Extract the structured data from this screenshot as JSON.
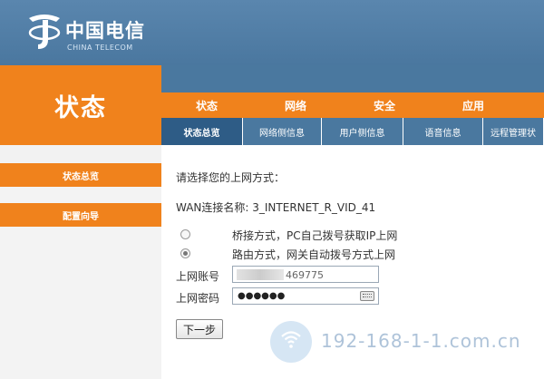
{
  "logo": {
    "cn": "中国电信",
    "en": "CHINA TELECOM"
  },
  "sidebar": {
    "title": "状态",
    "items": [
      {
        "label": "状态总览"
      },
      {
        "label": "配置向导"
      }
    ]
  },
  "main_tabs": [
    {
      "label": "状态"
    },
    {
      "label": "网络"
    },
    {
      "label": "安全"
    },
    {
      "label": "应用"
    }
  ],
  "sub_tabs": [
    {
      "label": "状态总览"
    },
    {
      "label": "网络侧信息"
    },
    {
      "label": "用户侧信息"
    },
    {
      "label": "语音信息"
    },
    {
      "label": "远程管理状"
    }
  ],
  "content": {
    "prompt": "请选择您的上网方式：",
    "wan_label": "WAN连接名称: 3_INTERNET_R_VID_41",
    "options": [
      {
        "label": "桥接方式，PC自己拨号获取IP上网",
        "checked": false
      },
      {
        "label": "路由方式，网关自动拨号方式上网",
        "checked": true
      }
    ],
    "account_label": "上网账号",
    "account_value": "469775",
    "password_label": "上网密码",
    "password_value": "●●●●●●",
    "next_button": "下一步"
  },
  "watermark": {
    "text": "192-168-1-1.com.cn"
  },
  "colors": {
    "orange": "#f0821c",
    "blue": "#4a789f",
    "dark_blue": "#2e5c86"
  }
}
